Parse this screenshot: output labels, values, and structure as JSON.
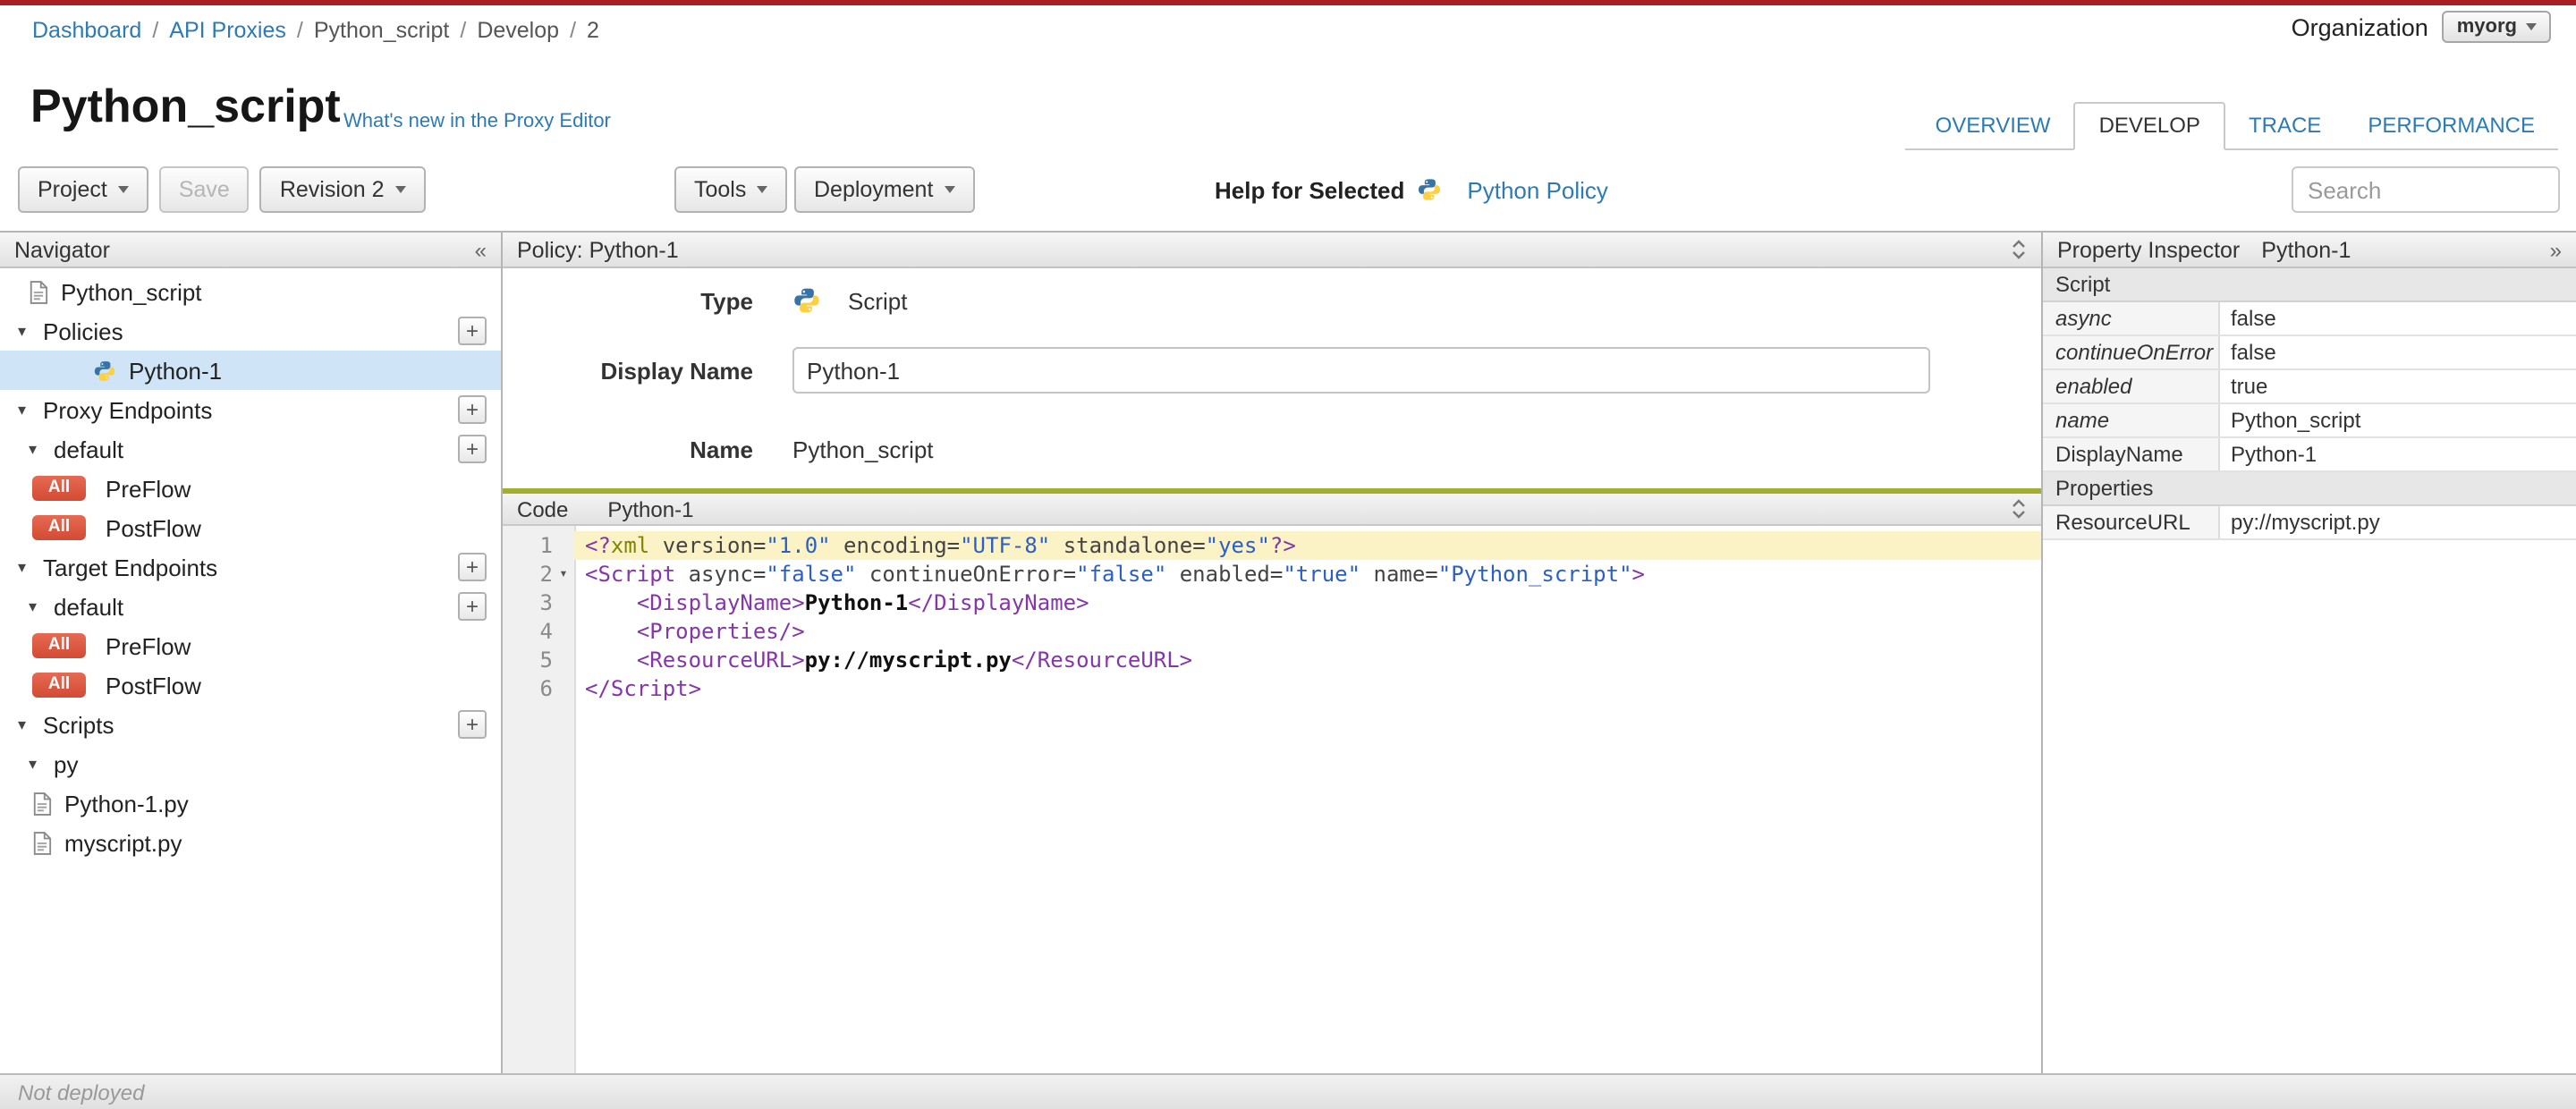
{
  "colors": {
    "accent_blue": "#2d7bb2",
    "topline_red": "#a81e22",
    "badge_red": "#d34a34",
    "selection_blue": "#cfe5f7",
    "active_line": "#fbf3c6",
    "code_header_green": "#a3ad32",
    "code_tag": "#8536a8",
    "code_string": "#2b5fc4",
    "code_attr": "#444444",
    "code_meta": "#7f8500"
  },
  "icons": {
    "collapse_icon": "«",
    "expand_icon": "»",
    "caret_down": "▾",
    "plus": "+"
  },
  "topbar": {
    "breadcrumb": [
      {
        "label": "Dashboard",
        "link": true
      },
      {
        "label": "API Proxies",
        "link": true
      },
      {
        "label": "Python_script",
        "link": false
      },
      {
        "label": "Develop",
        "link": false
      },
      {
        "label": "2",
        "link": false
      }
    ],
    "organization_label": "Organization",
    "organization_value": "myorg"
  },
  "header": {
    "title": "Python_script",
    "whats_new": "What's new in the Proxy Editor",
    "tabs": [
      {
        "label": "OVERVIEW",
        "active": false
      },
      {
        "label": "DEVELOP",
        "active": true
      },
      {
        "label": "TRACE",
        "active": false
      },
      {
        "label": "PERFORMANCE",
        "active": false
      }
    ]
  },
  "toolbar": {
    "project": "Project",
    "save": "Save",
    "revision": "Revision 2",
    "tools": "Tools",
    "deployment": "Deployment",
    "help_for_selected": "Help for Selected",
    "help_link": "Python Policy",
    "search_placeholder": "Search"
  },
  "navigator": {
    "title": "Navigator",
    "items": [
      {
        "kind": "rootdoc",
        "label": "Python_script",
        "icon": "doc"
      },
      {
        "kind": "section",
        "depth": 0,
        "label": "Policies",
        "plus": true
      },
      {
        "kind": "leaf",
        "label": "Python-1",
        "icon": "python",
        "selected": true
      },
      {
        "kind": "section",
        "depth": 0,
        "label": "Proxy Endpoints",
        "plus": true
      },
      {
        "kind": "section",
        "depth": 1,
        "label": "default",
        "plus": true
      },
      {
        "kind": "flow",
        "label": "PreFlow",
        "badge": "All"
      },
      {
        "kind": "flow",
        "label": "PostFlow",
        "badge": "All"
      },
      {
        "kind": "section",
        "depth": 0,
        "label": "Target Endpoints",
        "plus": true
      },
      {
        "kind": "section",
        "depth": 1,
        "label": "default",
        "plus": true
      },
      {
        "kind": "flow",
        "label": "PreFlow",
        "badge": "All"
      },
      {
        "kind": "flow",
        "label": "PostFlow",
        "badge": "All"
      },
      {
        "kind": "section",
        "depth": 0,
        "label": "Scripts",
        "plus": true
      },
      {
        "kind": "section",
        "depth": 1,
        "label": "py"
      },
      {
        "kind": "file",
        "label": "Python-1.py",
        "icon": "doc"
      },
      {
        "kind": "file",
        "label": "myscript.py",
        "icon": "doc"
      }
    ]
  },
  "editor": {
    "policy_header": "Policy: Python-1",
    "type_label": "Type",
    "type_value": "Script",
    "display_name_label": "Display Name",
    "display_name_value": "Python-1",
    "name_label": "Name",
    "name_value": "Python_script",
    "code_label": "Code",
    "code_title": "Python-1",
    "code_lines": [
      {
        "n": 1,
        "active": true,
        "tokens": [
          {
            "c": "tag",
            "v": "<?"
          },
          {
            "c": "meta",
            "v": "xml"
          },
          {
            "c": "attr",
            "v": " version="
          },
          {
            "c": "str",
            "v": "\"1.0\""
          },
          {
            "c": "attr",
            "v": " encoding="
          },
          {
            "c": "str",
            "v": "\"UTF-8\""
          },
          {
            "c": "attr",
            "v": " standalone="
          },
          {
            "c": "str",
            "v": "\"yes\""
          },
          {
            "c": "tag",
            "v": "?>"
          }
        ]
      },
      {
        "n": 2,
        "fold": true,
        "tokens": [
          {
            "c": "tag",
            "v": "<Script"
          },
          {
            "c": "attr",
            "v": " async="
          },
          {
            "c": "str",
            "v": "\"false\""
          },
          {
            "c": "attr",
            "v": " continueOnError="
          },
          {
            "c": "str",
            "v": "\"false\""
          },
          {
            "c": "attr",
            "v": " enabled="
          },
          {
            "c": "str",
            "v": "\"true\""
          },
          {
            "c": "attr",
            "v": " name="
          },
          {
            "c": "str",
            "v": "\"Python_script\""
          },
          {
            "c": "tag",
            "v": ">"
          }
        ]
      },
      {
        "n": 3,
        "tokens": [
          {
            "c": "plain",
            "v": "    "
          },
          {
            "c": "tag",
            "v": "<DisplayName>"
          },
          {
            "c": "text",
            "v": "Python-1"
          },
          {
            "c": "tag",
            "v": "</DisplayName>"
          }
        ]
      },
      {
        "n": 4,
        "tokens": [
          {
            "c": "plain",
            "v": "    "
          },
          {
            "c": "tag",
            "v": "<Properties/>"
          }
        ]
      },
      {
        "n": 5,
        "tokens": [
          {
            "c": "plain",
            "v": "    "
          },
          {
            "c": "tag",
            "v": "<ResourceURL>"
          },
          {
            "c": "text",
            "v": "py://myscript.py"
          },
          {
            "c": "tag",
            "v": "</ResourceURL>"
          }
        ]
      },
      {
        "n": 6,
        "tokens": [
          {
            "c": "tag",
            "v": "</Script>"
          }
        ]
      }
    ]
  },
  "inspector": {
    "title": "Property Inspector",
    "subtitle": "Python-1",
    "rows": [
      {
        "kind": "header",
        "label": "Script"
      },
      {
        "kind": "prop",
        "label": "async",
        "italic": true,
        "value": "false"
      },
      {
        "kind": "prop",
        "label": "continueOnError",
        "italic": true,
        "value": "false"
      },
      {
        "kind": "prop",
        "label": "enabled",
        "italic": true,
        "value": "true"
      },
      {
        "kind": "prop",
        "label": "name",
        "italic": true,
        "value": "Python_script"
      },
      {
        "kind": "prop",
        "label": "DisplayName",
        "italic": false,
        "value": "Python-1"
      },
      {
        "kind": "header",
        "label": "Properties"
      },
      {
        "kind": "prop",
        "label": "ResourceURL",
        "italic": false,
        "value": "py://myscript.py"
      }
    ]
  },
  "statusbar": {
    "text": "Not deployed"
  }
}
